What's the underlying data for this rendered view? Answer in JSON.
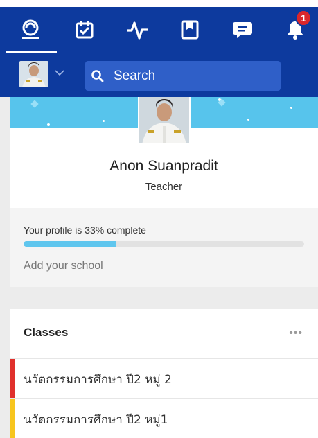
{
  "nav": {
    "items": [
      {
        "icon": "activity-feed-icon",
        "active": true
      },
      {
        "icon": "calendar-check-icon",
        "active": false
      },
      {
        "icon": "pulse-icon",
        "active": false
      },
      {
        "icon": "bookmark-book-icon",
        "active": false
      },
      {
        "icon": "chat-icon",
        "active": false
      },
      {
        "icon": "notifications-bell-icon",
        "active": false,
        "badge": "1"
      }
    ]
  },
  "search": {
    "label": "Search"
  },
  "profile": {
    "name": "Anon Suanpradit",
    "role": "Teacher"
  },
  "completion": {
    "text": "Your profile is 33% complete",
    "percent": 33,
    "add_school": "Add your school"
  },
  "classes": {
    "title": "Classes",
    "more": "•••",
    "items": [
      {
        "name": "นวัตกรรมการศึกษา ปี2 หมู่ 2",
        "color": "#e0302c"
      },
      {
        "name": "นวัตกรรมการศึกษา ปี2 หมู่1",
        "color": "#f7c51e"
      }
    ]
  },
  "colors": {
    "header": "#0d3a9e",
    "search_bg": "#2f5fc8",
    "banner": "#57c4ec",
    "progress": "#5fc6ee",
    "badge": "#d9262b"
  }
}
